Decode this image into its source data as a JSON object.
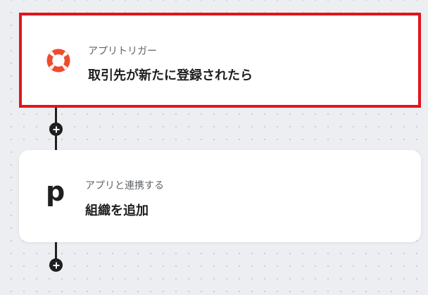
{
  "flow": {
    "trigger": {
      "subtitle": "アプリトリガー",
      "title": "取引先が新たに登録されたら",
      "icon": "lifebuoy-icon",
      "accent": "#e0151b"
    },
    "action": {
      "subtitle": "アプリと連携する",
      "title": "組織を追加",
      "icon": "pipedrive-p-logo",
      "logo_letter": "p"
    }
  },
  "colors": {
    "canvas": "#eceef1",
    "connector": "#1f1f1f",
    "highlight_border": "#e0151b"
  }
}
